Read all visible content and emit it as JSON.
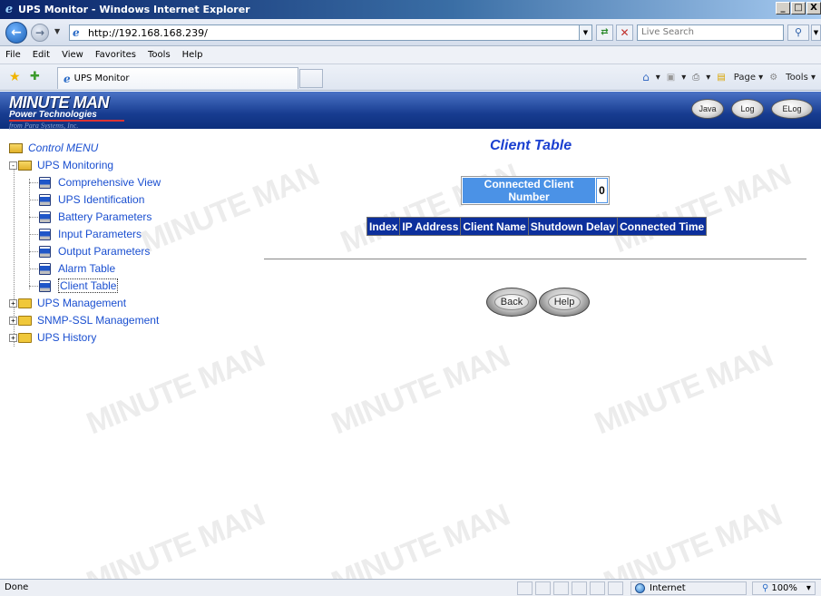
{
  "window": {
    "title": "UPS Monitor - Windows Internet Explorer",
    "controls": [
      "_",
      "□",
      "X"
    ]
  },
  "address_bar": {
    "url": "http://192.168.168.239/",
    "search_placeholder": "Live Search"
  },
  "menu": [
    "File",
    "Edit",
    "View",
    "Favorites",
    "Tools",
    "Help"
  ],
  "tab": {
    "label": "UPS Monitor"
  },
  "command_bar": {
    "page": "Page",
    "tools": "Tools"
  },
  "banner": {
    "logo_line1": "MINUTE MAN",
    "logo_line2": "Power Technologies",
    "logo_line3": "from Para Systems, Inc.",
    "buttons": {
      "java": "Java",
      "log": "Log",
      "elog": "ELog"
    }
  },
  "tree": {
    "root": "Control MENU",
    "ups_monitoring": "UPS Monitoring",
    "items": [
      "Comprehensive View",
      "UPS Identification",
      "Battery Parameters",
      "Input Parameters",
      "Output Parameters",
      "Alarm Table",
      "Client Table"
    ],
    "ups_management": "UPS Management",
    "snmp_ssl": "SNMP-SSL Management",
    "ups_history": "UPS History"
  },
  "main": {
    "title": "Client Table",
    "connected_label": "Connected Client Number",
    "connected_value": "0",
    "table_headers": [
      "Index",
      "IP Address",
      "Client Name",
      "Shutdown Delay",
      "Connected Time"
    ],
    "back_label": "Back",
    "help_label": "Help"
  },
  "watermark": "MINUTE MAN",
  "status_bar": {
    "text": "Done",
    "zone": "Internet",
    "zoom": "100%"
  }
}
